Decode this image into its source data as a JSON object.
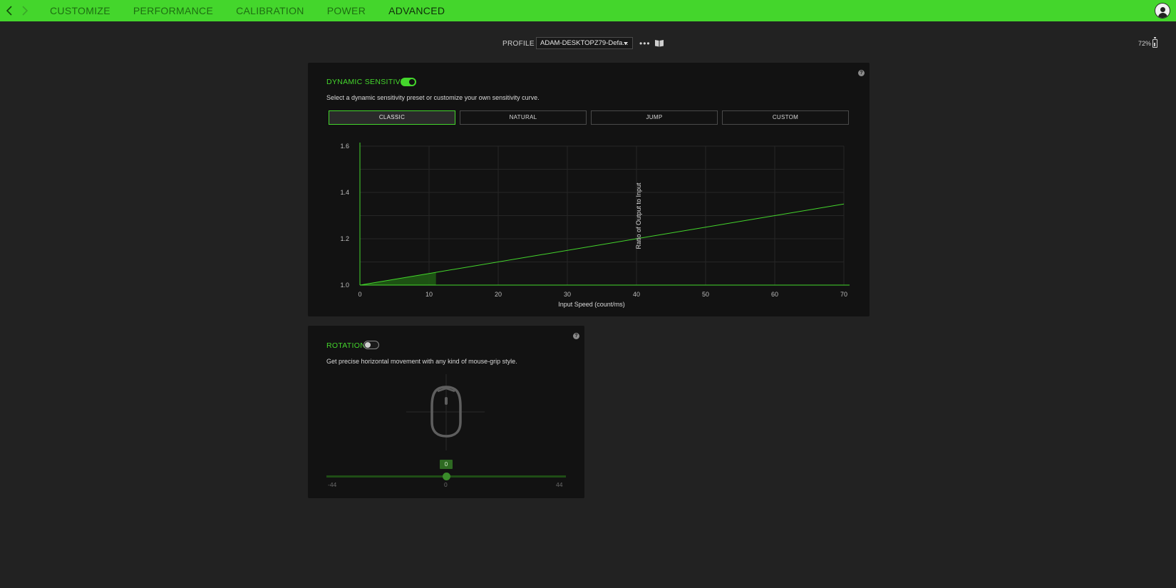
{
  "nav": {
    "back_icon": "chevron-left-icon",
    "forward_icon": "chevron-right-icon",
    "tabs": [
      {
        "label": "CUSTOMIZE"
      },
      {
        "label": "PERFORMANCE"
      },
      {
        "label": "CALIBRATION"
      },
      {
        "label": "POWER"
      },
      {
        "label": "ADVANCED"
      }
    ],
    "active_tab": "ADVANCED",
    "accent_color": "#44d62c"
  },
  "profile": {
    "label": "PROFILE",
    "selected": "ADAM-DESKTOPZ79-Defa...",
    "more_label": "•••"
  },
  "battery": {
    "percent_label": "72%"
  },
  "dynamic_sensitivity": {
    "title": "DYNAMIC SENSITIVITY",
    "enabled": true,
    "description": "Select a dynamic sensitivity preset or customize your own sensitivity curve.",
    "help": "?",
    "presets": [
      {
        "label": "CLASSIC"
      },
      {
        "label": "NATURAL"
      },
      {
        "label": "JUMP"
      },
      {
        "label": "CUSTOM"
      }
    ],
    "active_preset": "CLASSIC"
  },
  "chart_data": {
    "type": "line",
    "xlabel": "Input Speed (count/ms)",
    "ylabel": "Ratio of Output to Input",
    "xlim": [
      0,
      70
    ],
    "ylim": [
      1.0,
      1.6
    ],
    "x_ticks": [
      "0",
      "10",
      "20",
      "30",
      "40",
      "50",
      "60",
      "70"
    ],
    "y_ticks": [
      "1.0",
      "1.2",
      "1.4",
      "1.6"
    ],
    "grid": true,
    "series": [
      {
        "x": [
          0,
          70
        ],
        "y": [
          1.0,
          1.35
        ]
      }
    ],
    "shaded_region": {
      "x": [
        0,
        11
      ],
      "note_color": "#1f5a14"
    }
  },
  "rotation": {
    "title": "ROTATION",
    "enabled": false,
    "description": "Get precise horizontal movement with any kind of mouse-grip style.",
    "help": "?",
    "value": "0",
    "min_label": "-44",
    "mid_label": "0",
    "max_label": "44",
    "min": -44,
    "max": 44,
    "current": 0
  }
}
